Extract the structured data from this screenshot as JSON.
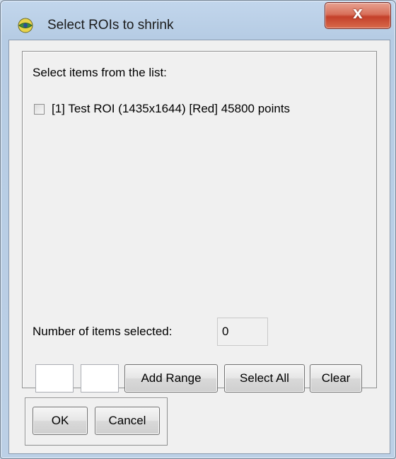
{
  "window": {
    "title": "Select ROIs to shrink",
    "close_glyph": "X",
    "icon": "app-globe-icon"
  },
  "list": {
    "prompt": "Select items from the list:",
    "items": [
      {
        "label": "[1] Test ROI (1435x1644) [Red] 45800 points",
        "checked": false
      }
    ]
  },
  "selection": {
    "count_label": "Number of items selected:",
    "count_value": "0"
  },
  "range": {
    "from_value": "",
    "to_value": "",
    "add_range_label": "Add Range",
    "select_all_label": "Select All",
    "clear_label": "Clear"
  },
  "footer": {
    "ok_label": "OK",
    "cancel_label": "Cancel"
  }
}
